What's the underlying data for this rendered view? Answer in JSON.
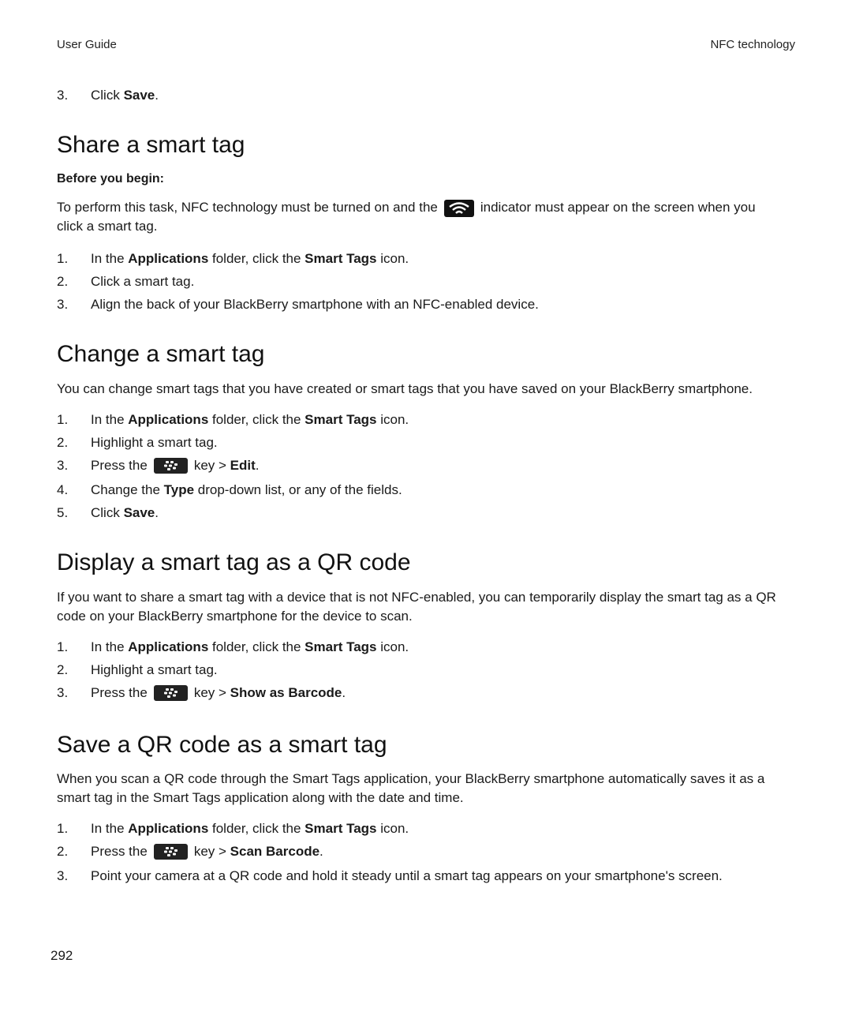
{
  "header": {
    "left": "User Guide",
    "right": "NFC technology"
  },
  "top_step": {
    "num": "3.",
    "pre": "Click ",
    "bold": "Save",
    "post": "."
  },
  "sections": {
    "share": {
      "title": "Share a smart tag",
      "before_label": "Before you begin:",
      "para_pre": "To perform this task, NFC technology must be turned on and the",
      "para_icon": "nfc-indicator-icon",
      "para_post": "indicator must appear on the screen when you",
      "para_line2": "click a smart tag.",
      "steps": [
        {
          "num": "1.",
          "t1": "In the ",
          "b1": "Applications",
          "t2": " folder, click the ",
          "b2": "Smart Tags",
          "t3": " icon."
        },
        {
          "num": "2.",
          "t1": "Click a smart tag."
        },
        {
          "num": "3.",
          "t1": "Align the back of your BlackBerry smartphone with an NFC-enabled device."
        }
      ]
    },
    "change": {
      "title": "Change a smart tag",
      "para": "You can change smart tags that you have created or smart tags that you have saved on your BlackBerry smartphone.",
      "steps": [
        {
          "num": "1.",
          "t1": "In the ",
          "b1": "Applications",
          "t2": " folder, click the ",
          "b2": "Smart Tags",
          "t3": " icon."
        },
        {
          "num": "2.",
          "t1": "Highlight a smart tag."
        },
        {
          "num": "3.",
          "t1": "Press the",
          "icon": "blackberry-menu-key-icon",
          "t2": "key > ",
          "b1": "Edit",
          "t3": "."
        },
        {
          "num": "4.",
          "t1": "Change the ",
          "b1": "Type",
          "t2": " drop-down list, or any of the fields."
        },
        {
          "num": "5.",
          "t1": "Click ",
          "b1": "Save",
          "t2": "."
        }
      ]
    },
    "display": {
      "title": "Display a smart tag as a QR code",
      "para": "If you want to share a smart tag with a device that is not NFC-enabled, you can temporarily display the smart tag as a QR code on your BlackBerry smartphone for the device to scan.",
      "steps": [
        {
          "num": "1.",
          "t1": "In the ",
          "b1": "Applications",
          "t2": " folder, click the ",
          "b2": "Smart Tags",
          "t3": " icon."
        },
        {
          "num": "2.",
          "t1": "Highlight a smart tag."
        },
        {
          "num": "3.",
          "t1": "Press the",
          "icon": "blackberry-menu-key-icon",
          "t2": "key > ",
          "b1": "Show as Barcode",
          "t3": "."
        }
      ]
    },
    "save": {
      "title": "Save a QR code as a smart tag",
      "para": "When you scan a QR code through the Smart Tags application, your BlackBerry smartphone automatically saves it as a smart tag in the Smart Tags application along with the date and time.",
      "steps": [
        {
          "num": "1.",
          "t1": "In the ",
          "b1": "Applications",
          "t2": " folder, click the ",
          "b2": "Smart Tags",
          "t3": " icon."
        },
        {
          "num": "2.",
          "t1": "Press the",
          "icon": "blackberry-menu-key-icon",
          "t2": "key > ",
          "b1": "Scan Barcode",
          "t3": "."
        },
        {
          "num": "3.",
          "t1": "Point your camera at a QR code and hold it steady until a smart tag appears on your smartphone's screen."
        }
      ]
    }
  },
  "page_number": "292"
}
